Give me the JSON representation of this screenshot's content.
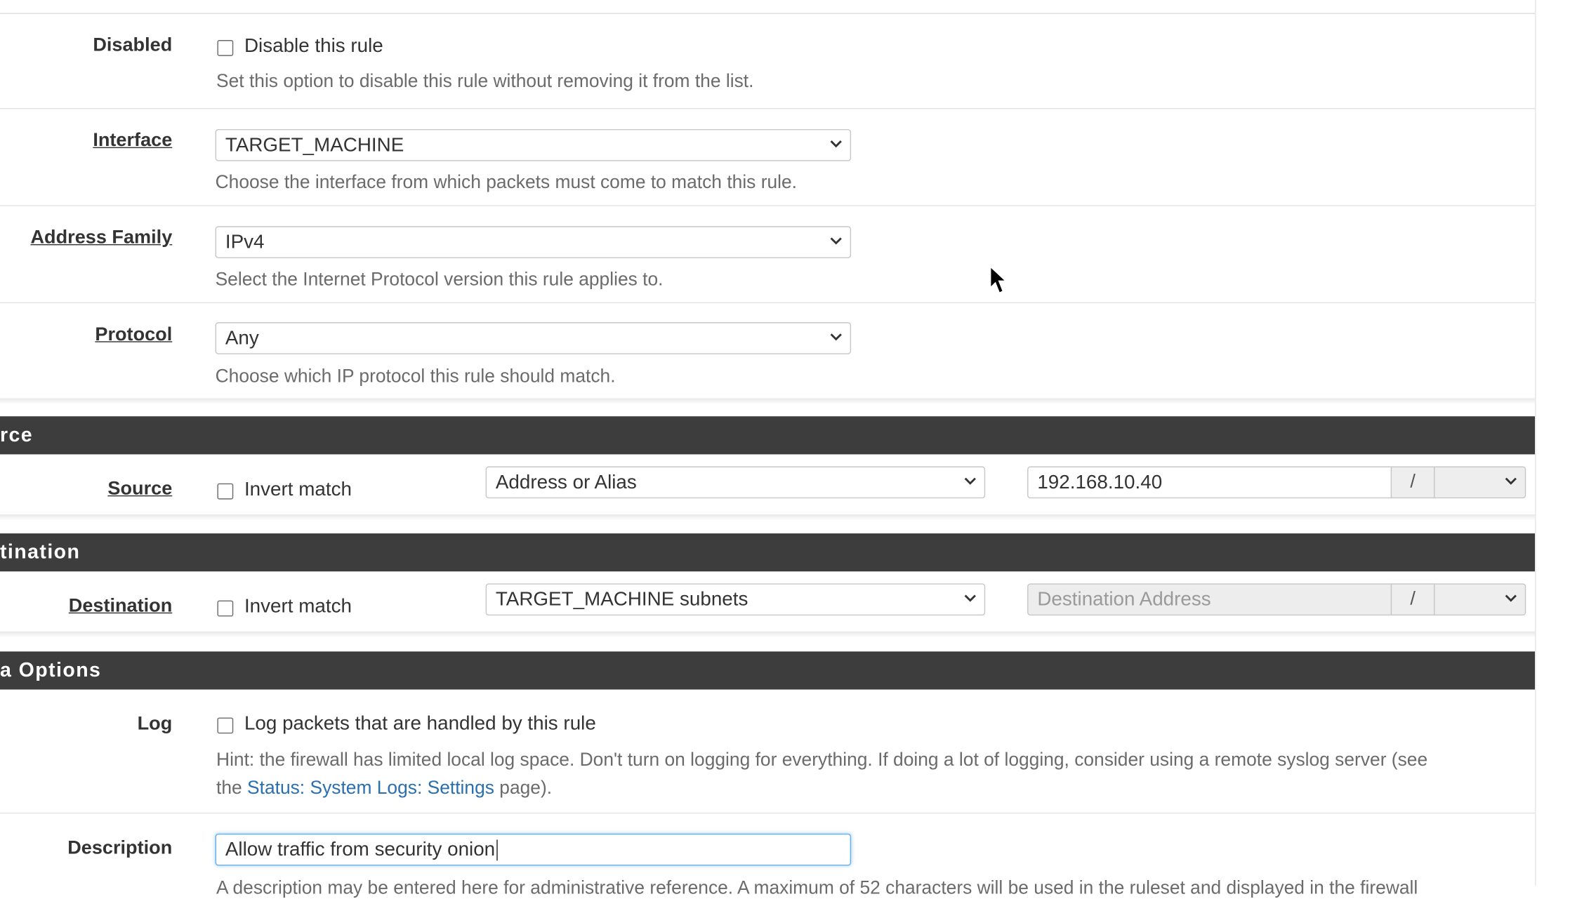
{
  "form": {
    "disabled": {
      "label": "Disabled",
      "checkbox_label": "Disable this rule",
      "help": "Set this option to disable this rule without removing it from the list."
    },
    "interface": {
      "label": "Interface",
      "value": "TARGET_MACHINE",
      "help": "Choose the interface from which packets must come to match this rule."
    },
    "address_family": {
      "label": "Address Family",
      "value": "IPv4",
      "help": "Select the Internet Protocol version this rule applies to."
    },
    "protocol": {
      "label": "Protocol",
      "value": "Any",
      "help": "Choose which IP protocol this rule should match."
    }
  },
  "source_section": {
    "title": "rce",
    "label": "Source",
    "invert_label": "Invert match",
    "type_value": "Address or Alias",
    "address_value": "192.168.10.40",
    "slash": "/"
  },
  "destination_section": {
    "title": "tination",
    "label": "Destination",
    "invert_label": "Invert match",
    "type_value": "TARGET_MACHINE subnets",
    "address_placeholder": "Destination Address",
    "slash": "/"
  },
  "extra_section": {
    "title": "a Options",
    "log": {
      "label": "Log",
      "checkbox_label": "Log packets that are handled by this rule",
      "hint_prefix": "Hint: the firewall has limited local log space. Don't turn on logging for everything. If doing a lot of logging, consider using a remote syslog server (see",
      "hint_the": "the ",
      "hint_link": "Status: System Logs: Settings",
      "hint_suffix": " page)."
    },
    "description": {
      "label": "Description",
      "value": "Allow traffic from security onion",
      "help_partial": "A description may be entered here for administrative reference. A maximum of 52 characters will be used in the ruleset and displayed in the firewall"
    }
  },
  "colors": {
    "section_bar": "#3d3d3d",
    "link": "#2a6fb0",
    "focus": "#66afe9"
  }
}
